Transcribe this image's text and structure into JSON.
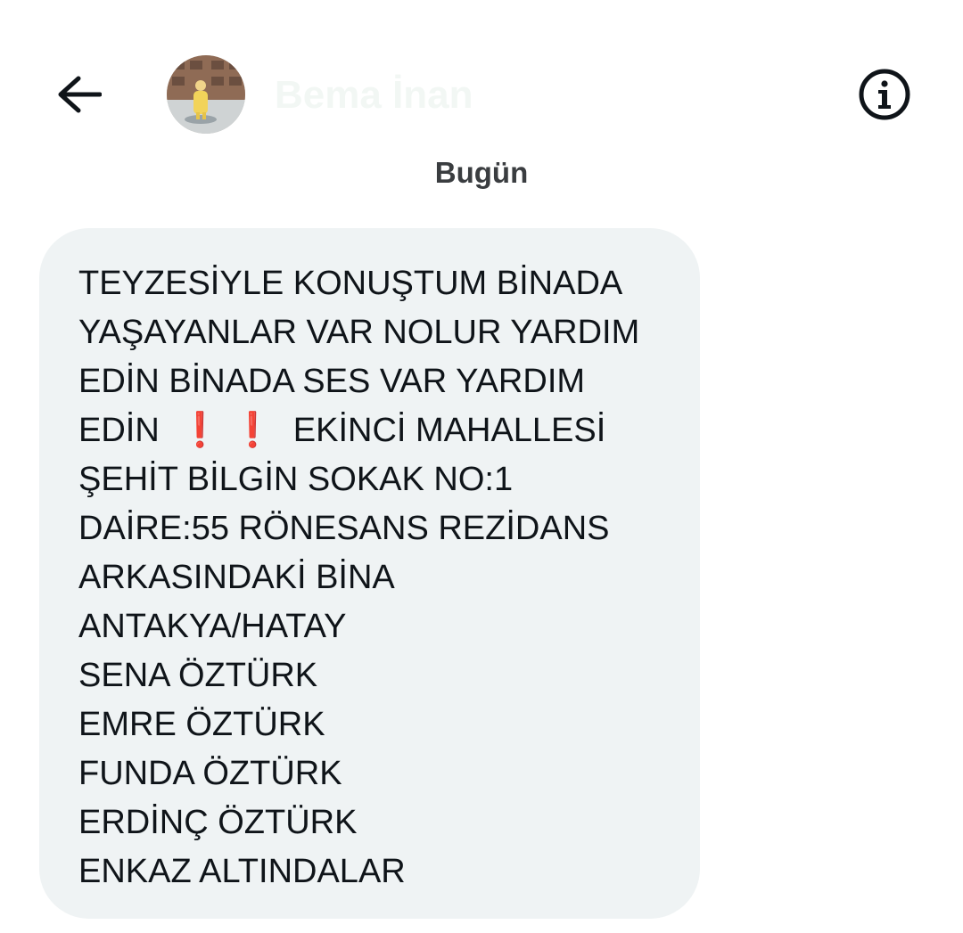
{
  "header": {
    "back_icon": "arrow-left-icon",
    "contact_name": "Bema İnan",
    "avatar": "profile-photo",
    "info_icon": "info-circle-icon"
  },
  "date_separator": "Bugün",
  "message": {
    "lines": [
      "TEYZESİYLE KONUŞTUM BİNADA",
      "YAŞAYANLAR VAR NOLUR YARDIM",
      "EDİN BİNADA SES VAR YARDIM",
      "ŞEHİT BİLGİN SOKAK NO:1",
      "DAİRE:55 RÖNESANS REZİDANS",
      "ARKASINDAKİ BİNA",
      "ANTAKYA/HATAY",
      "SENA ÖZTÜRK",
      "EMRE ÖZTÜRK",
      "FUNDA ÖZTÜRK",
      "ERDİNÇ ÖZTÜRK",
      "ENKAZ ALTINDALAR"
    ],
    "line4": {
      "prefix": "EDİN",
      "emoji": "❗",
      "suffix": "EKİNCİ MAHALLESİ"
    }
  },
  "colors": {
    "bubble": "#eff3f4",
    "text": "#0f1419",
    "exclamation": "#d9162f"
  }
}
